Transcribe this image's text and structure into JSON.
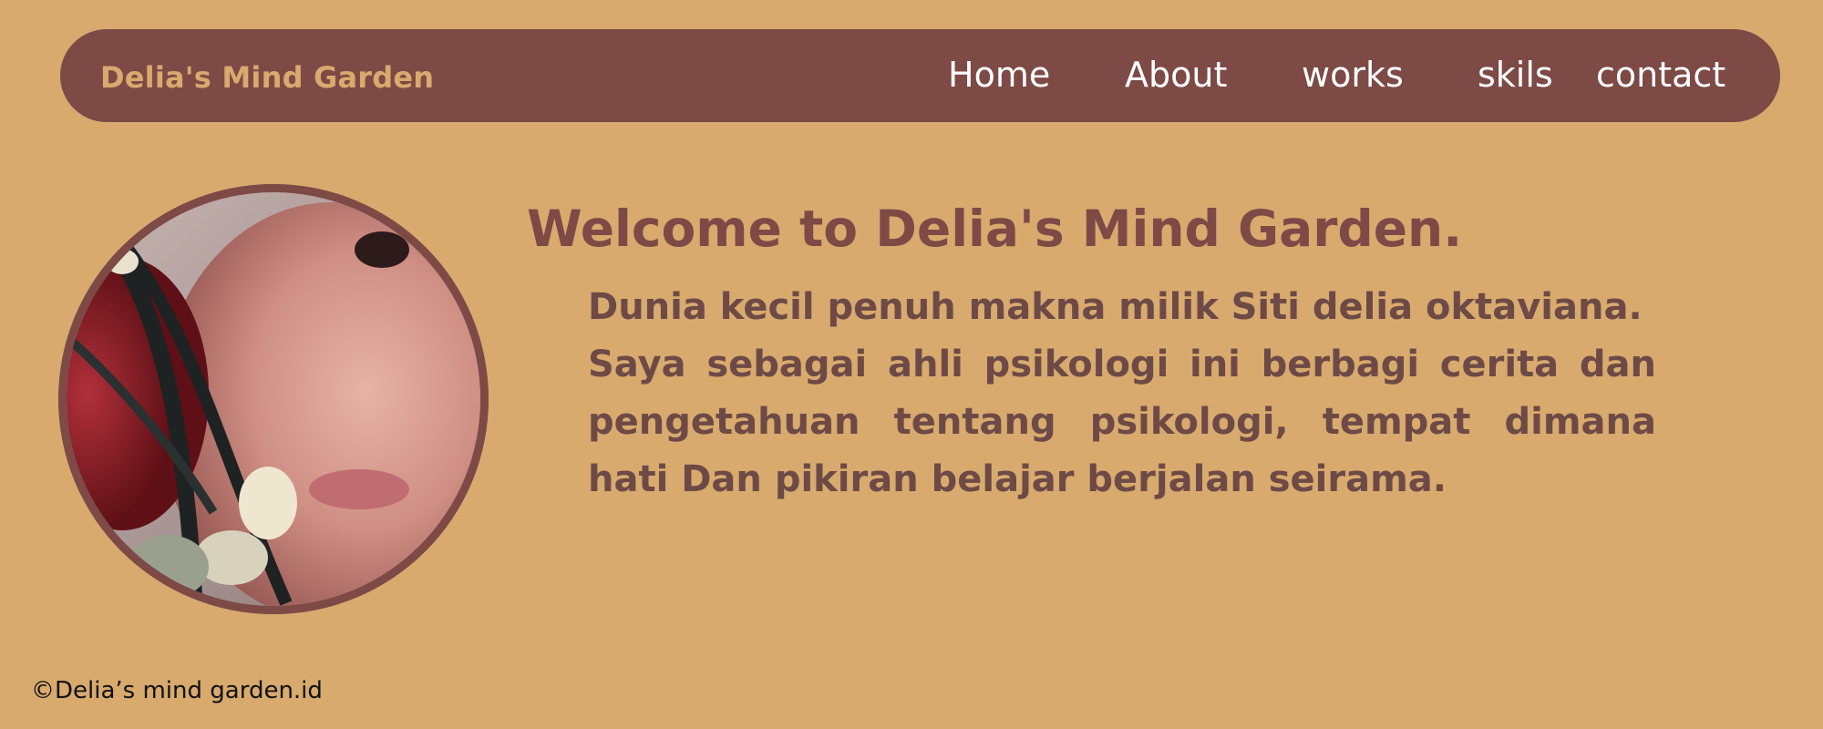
{
  "header": {
    "brand": "Delia's Mind Garden",
    "nav": [
      {
        "label": "Home"
      },
      {
        "label": "About"
      },
      {
        "label": "works"
      },
      {
        "label": "skils"
      },
      {
        "label": "contact"
      }
    ]
  },
  "hero": {
    "title": "Welcome to Delia's Mind Garden.",
    "paragraphs": [
      "Dunia kecil penuh makna milik Siti delia oktaviana.",
      "Saya sebagai ahli psikologi ini berbagi cerita dan pengetahuan tentang psikologi, tempat dimana hati Dan pikiran belajar berjalan seirama."
    ]
  },
  "footer": {
    "copyright": "©Delia’s mind garden.id"
  },
  "colors": {
    "background": "#d8aa6e",
    "primary": "#7d4a46",
    "nav_text": "#ffffff",
    "body_text": "#6d4a46"
  }
}
